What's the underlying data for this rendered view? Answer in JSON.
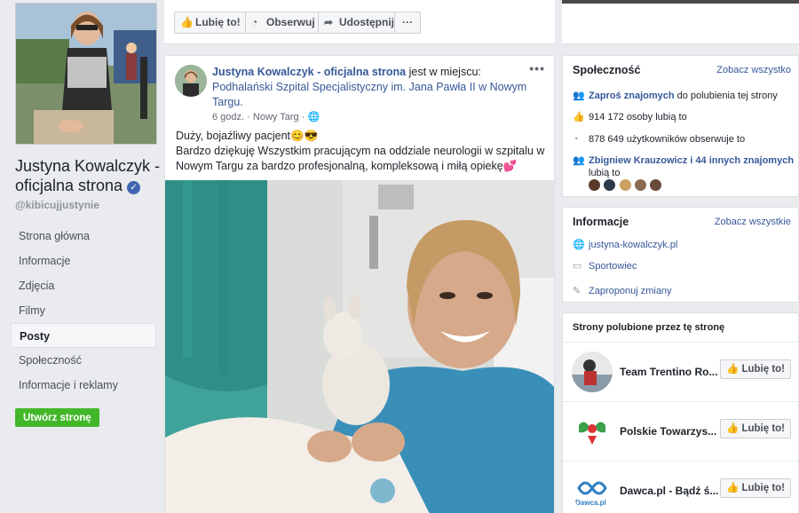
{
  "left": {
    "page_name": "Justyna Kowalczyk - oficjalna strona",
    "handle": "@kibicujjustynie",
    "nav": [
      {
        "label": "Strona główna"
      },
      {
        "label": "Informacje"
      },
      {
        "label": "Zdjęcia"
      },
      {
        "label": "Filmy"
      },
      {
        "label": "Posty"
      },
      {
        "label": "Społeczność"
      },
      {
        "label": "Informacje i reklamy"
      }
    ],
    "create_page": "Utwórz stronę"
  },
  "actionbar": {
    "like": "Lubię to!",
    "follow": "Obserwuj",
    "share": "Udostępnij",
    "more": "···"
  },
  "post": {
    "author": "Justyna Kowalczyk - oficjalna strona",
    "at_text": " jest w miejscu: ",
    "place": "Podhalański Szpital Specjalistyczny im. Jana Pawła II w Nowym Targu.",
    "time": "6 godz.",
    "location": "Nowy Targ",
    "line1": "Duży, bojaźliwy pacjent😊😎",
    "line2": "Bardzo dziękuję Wszystkim pracującym na oddziale neurologii w szpitalu w Nowym Targu za bardzo profesjonalną, kompleksową i miłą opiekę💕"
  },
  "community": {
    "title": "Społeczność",
    "see_all": "Zobacz wszystko",
    "invite_link": "Zaproś znajomych",
    "invite_rest": " do polubienia tej strony",
    "likes": "914 172 osoby lubią to",
    "follows": "878 649 użytkowników obserwuje to",
    "friends_link": "Zbigniew Krauzowicz i 44 innych znajomych",
    "friends_rest": "lubią to"
  },
  "info": {
    "title": "Informacje",
    "see_all": "Zobacz wszystkie",
    "website": "justyna-kowalczyk.pl",
    "category": "Sportowiec",
    "suggest": "Zaproponuj zmiany"
  },
  "liked": {
    "title": "Strony polubione przez tę stronę",
    "items": [
      {
        "name": "Team Trentino Ro...",
        "button": "Lubię to!"
      },
      {
        "name": "Polskie Towarzys...",
        "button": "Lubię to!"
      },
      {
        "name": "Dawca.pl - Bądź ś...",
        "button": "Lubię to!"
      }
    ],
    "dawca_logo_text": "Dawca.pl"
  },
  "colors": {
    "fb_blue": "#4267b2",
    "link": "#365899",
    "green": "#42b72a"
  }
}
